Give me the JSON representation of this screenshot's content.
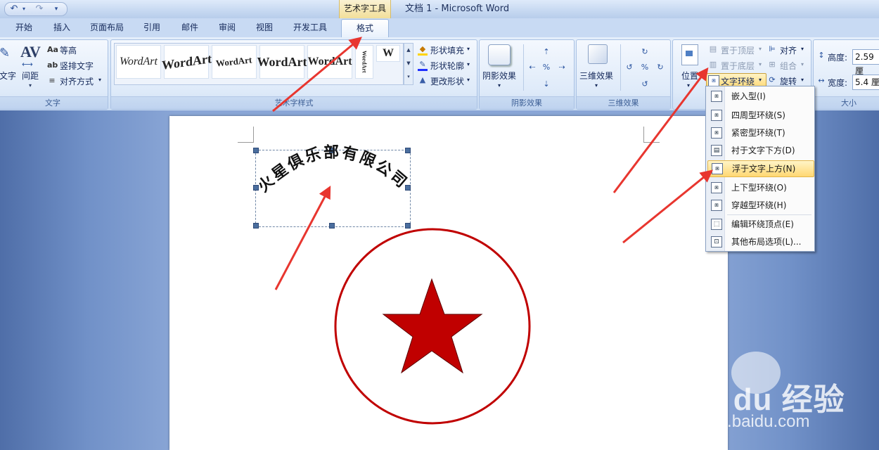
{
  "titlebar": {
    "context_tools_label": "艺术字工具",
    "doc_title": "文档 1 - Microsoft Word",
    "qat": {
      "undo_icon": "undo-icon",
      "redo_icon": "redo-icon",
      "customize_icon": "dropdown-arrow-icon"
    }
  },
  "tabs": [
    {
      "label": "开始"
    },
    {
      "label": "插入"
    },
    {
      "label": "页面布局"
    },
    {
      "label": "引用"
    },
    {
      "label": "邮件"
    },
    {
      "label": "审阅"
    },
    {
      "label": "视图"
    },
    {
      "label": "开发工具"
    },
    {
      "label": "格式",
      "active": true
    }
  ],
  "ribbon": {
    "text_group": {
      "label": "文字",
      "edit_text": "文字",
      "spacing": "间距",
      "equal_height": "等高",
      "vertical_text": "竖排文字",
      "align_text": "对齐方式"
    },
    "wordart_styles": {
      "label": "艺术字样式",
      "samples": [
        "WordArt",
        "WordArt",
        "WordArt",
        "WordArt",
        "WordArt",
        "WordArt",
        "W"
      ],
      "shape_fill": "形状填充",
      "shape_outline": "形状轮廓",
      "change_shape": "更改形状"
    },
    "shadow_group": {
      "label": "阴影效果",
      "shadow_effects": "阴影效果"
    },
    "threed_group": {
      "label": "三维效果",
      "threed_effects": "三维效果"
    },
    "arrange_group": {
      "position": "位置",
      "bring_front": "置于顶层",
      "send_back": "置于底层",
      "text_wrap": "文字环绕",
      "align": "对齐",
      "group": "组合",
      "rotate": "旋转"
    },
    "size_group": {
      "label": "大小",
      "height_label": "高度:",
      "height_value": "2.59 厘",
      "width_label": "宽度:",
      "width_value": "5.4 厘"
    }
  },
  "document": {
    "wordart_text": "火星俱乐部有限公司",
    "star_color": "#c00000",
    "circle_color": "#c00000"
  },
  "wrap_menu": {
    "items": [
      {
        "label": "嵌入型(I)",
        "highlight": false
      },
      {
        "label": "四周型环绕(S)",
        "highlight": false
      },
      {
        "label": "紧密型环绕(T)",
        "highlight": false
      },
      {
        "label": "衬于文字下方(D)",
        "highlight": false
      },
      {
        "label": "浮于文字上方(N)",
        "highlight": true
      },
      {
        "label": "上下型环绕(O)",
        "highlight": false
      },
      {
        "label": "穿越型环绕(H)",
        "highlight": false
      },
      {
        "label": "编辑环绕顶点(E)",
        "highlight": false
      },
      {
        "label": "其他布局选项(L)...",
        "highlight": false
      }
    ]
  },
  "watermark": {
    "brand": "Bai du 经验",
    "url": "jingyan.baidu.com"
  },
  "colors": {
    "annotation_arrow": "#e8362f",
    "ribbon_bg": "#dae7f8",
    "menu_highlight": "#ffd873"
  }
}
